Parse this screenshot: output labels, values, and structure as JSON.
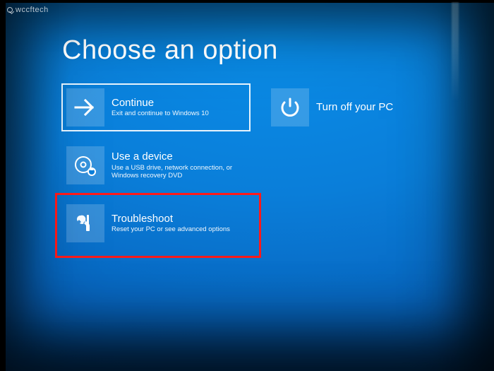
{
  "watermark": "wccftech",
  "title": "Choose an option",
  "tiles": {
    "continue": {
      "label": "Continue",
      "desc": "Exit and continue to Windows 10",
      "icon": "arrow-right-icon"
    },
    "use_device": {
      "label": "Use a device",
      "desc": "Use a USB drive, network connection, or Windows recovery DVD",
      "icon": "disc-usb-icon"
    },
    "troubleshoot": {
      "label": "Troubleshoot",
      "desc": "Reset your PC or see advanced options",
      "icon": "tools-icon"
    },
    "turn_off": {
      "label": "Turn off your PC",
      "icon": "power-icon"
    }
  },
  "annotation": {
    "highlighted_tile": "troubleshoot",
    "color": "#ff1a1a"
  },
  "colors": {
    "tile_icon_bg": "rgba(255,255,255,0.18)",
    "selection_outline": "rgba(255,255,255,0.9)"
  }
}
